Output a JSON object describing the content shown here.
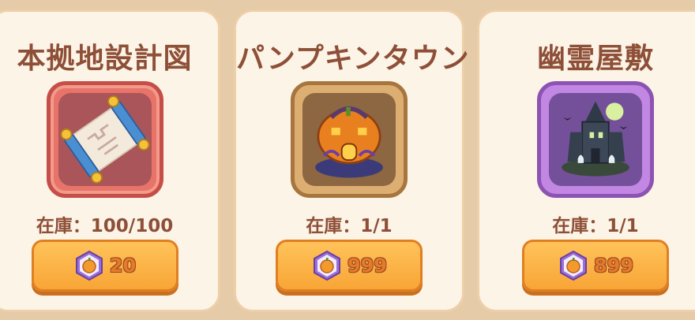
{
  "items": [
    {
      "title": "本拠地設計図",
      "stock": "在庫：100/100",
      "price": "20",
      "image_icon": "blueprint-scroll-icon"
    },
    {
      "title": "パンプキンタウン",
      "stock": "在庫：1/1",
      "price": "999",
      "image_icon": "pumpkin-house-icon"
    },
    {
      "title": "幽霊屋敷",
      "stock": "在庫：1/1",
      "price": "899",
      "image_icon": "haunted-mansion-icon"
    }
  ],
  "currency_icon": "pumpkin-coin-icon",
  "colors": {
    "background": "#e6cba9",
    "card": "#fcf4e6",
    "text": "#8e4f38",
    "button": "#f8a536",
    "red_frame": "#e77369",
    "brown_frame": "#ddae72",
    "purple_frame": "#c187e2"
  }
}
